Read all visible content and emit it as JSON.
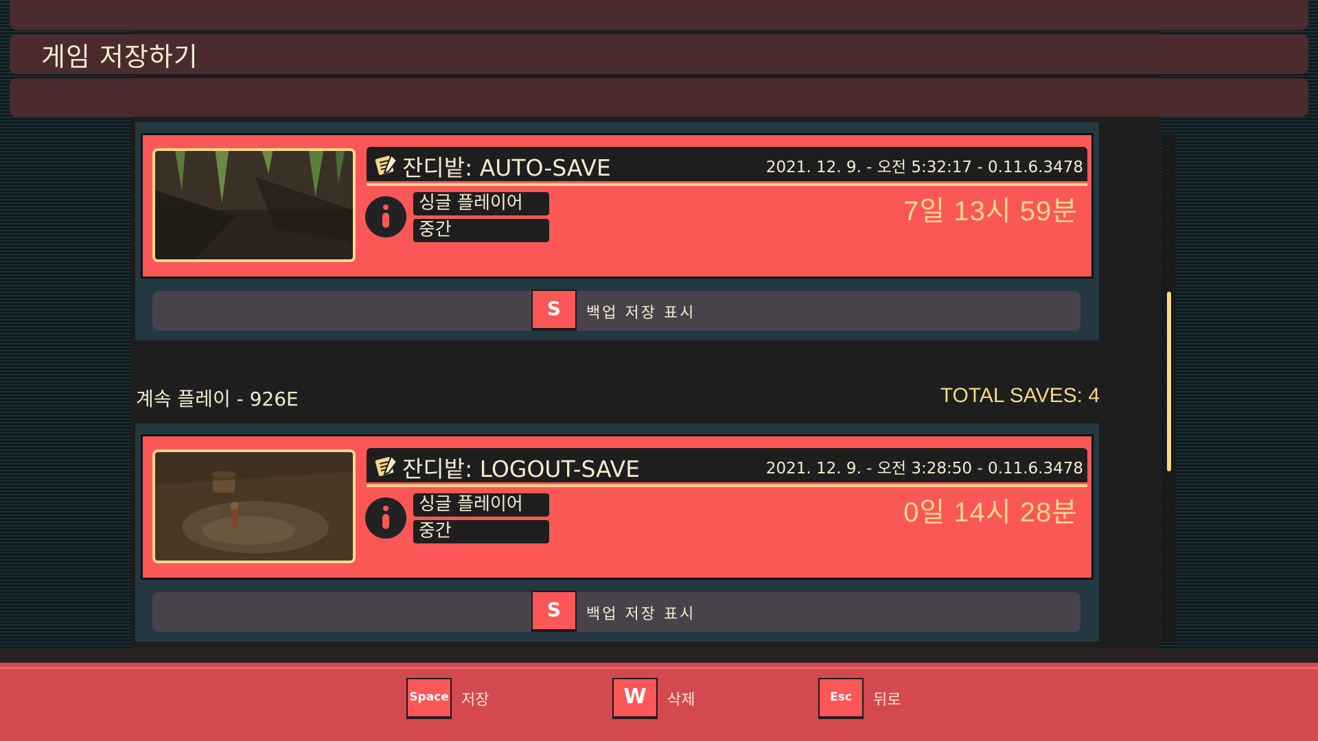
{
  "header": {
    "title": "게임 저장하기"
  },
  "groups": [
    {
      "saves": [
        {
          "name": "잔디밭: AUTO-SAVE",
          "meta": "2021. 12. 9. - 오전 5:32:17 - 0.11.6.3478",
          "mode": "싱글 플레이어",
          "difficulty": "중간",
          "playtime": "7일 13시 59분",
          "icon": "note-pencil-icon"
        }
      ],
      "backup": {
        "key": "S",
        "label": "백업 저장 표시"
      }
    },
    {
      "label": "계속 플레이 - 926E",
      "total": "TOTAL SAVES: 4",
      "saves": [
        {
          "name": "잔디밭: LOGOUT-SAVE",
          "meta": "2021. 12. 9. - 오전 3:28:50 - 0.11.6.3478",
          "mode": "싱글 플레이어",
          "difficulty": "중간",
          "playtime": "0일 14시 28분",
          "icon": "note-pencil-icon"
        }
      ],
      "backup": {
        "key": "S",
        "label": "백업 저장 표시"
      }
    }
  ],
  "footer": {
    "hints": [
      {
        "key": "Space",
        "label": "저장"
      },
      {
        "key": "W",
        "label": "삭제"
      },
      {
        "key": "Esc",
        "label": "뒤로"
      }
    ]
  },
  "colors": {
    "accent": "#fc5757",
    "cream": "#f8d98a",
    "panel": "#233841",
    "footer": "#d4494f"
  }
}
